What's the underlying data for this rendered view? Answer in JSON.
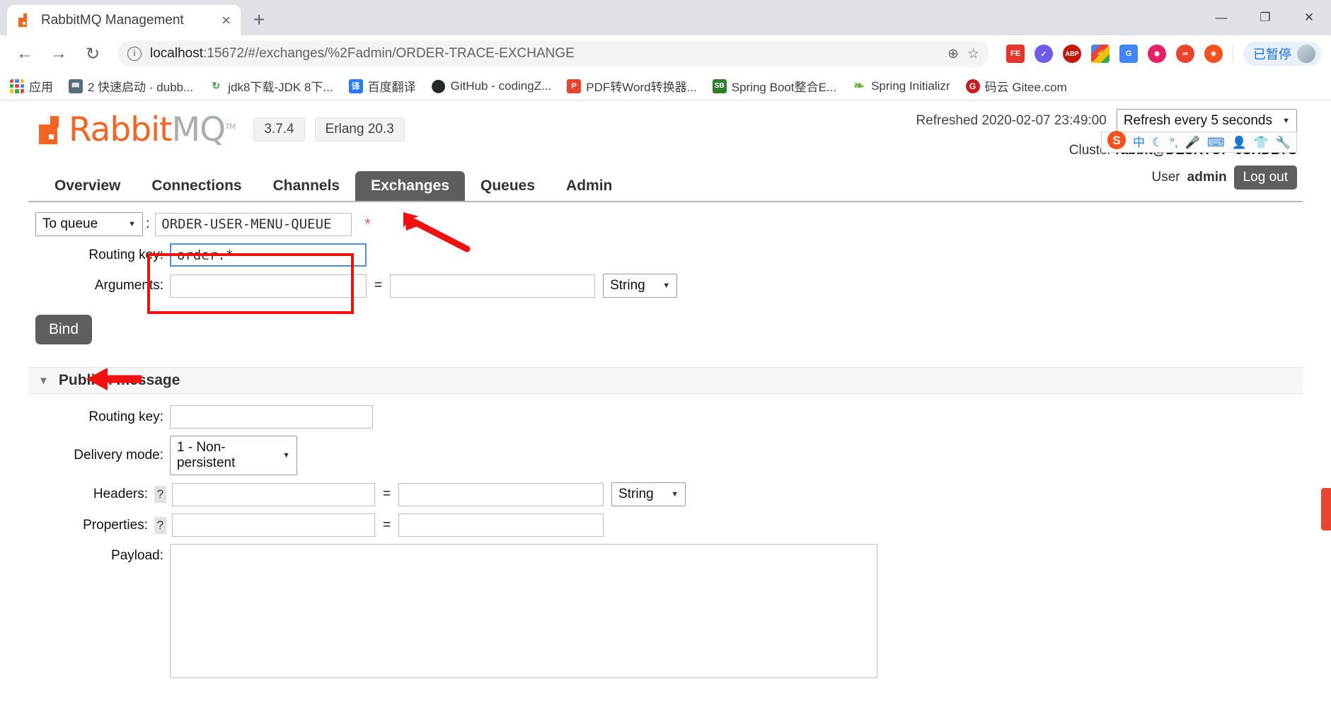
{
  "browser": {
    "tab": {
      "title": "RabbitMQ Management",
      "favicon": "rabbitmq-icon",
      "close": "×"
    },
    "newtab_label": "+",
    "window_controls": {
      "minimize": "—",
      "maximize": "❐",
      "close": "✕"
    },
    "nav": {
      "back": "←",
      "forward": "→",
      "reload": "↻"
    },
    "omnibox": {
      "info_icon": "ⓘ",
      "url_host": "localhost",
      "url_rest": ":15672/#/exchanges/%2Fadmin/ORDER-TRACE-EXCHANGE",
      "zoom_icon": "⊕",
      "bookmark_icon": "☆"
    },
    "extensions": [
      {
        "name": "fe-extension",
        "label": "FE",
        "color": "#e8342a"
      },
      {
        "name": "check-extension",
        "label": "✓",
        "color": "#6c5ce7"
      },
      {
        "name": "adblock-plus-extension",
        "label": "ABP",
        "color": "#c4170c"
      },
      {
        "name": "lightning-extension",
        "label": "⚡",
        "color": "#34a853"
      },
      {
        "name": "google-translate-extension",
        "label": "G",
        "color": "#4285f4"
      },
      {
        "name": "photos-extension",
        "label": "✿",
        "color": "#e91e63"
      },
      {
        "name": "infinity-extension",
        "label": "∞",
        "color": "#e8452c"
      },
      {
        "name": "odnoklassniki-extension",
        "label": "✶",
        "color": "#f4511e"
      }
    ],
    "paused_label": "已暂停",
    "bookmarks": [
      {
        "name": "apps",
        "label": "应用",
        "icon": "apps-grid",
        "color": ""
      },
      {
        "name": "dubbo-bookmark",
        "label": "2 快速启动 · dubb...",
        "icon": "book",
        "color": "#546e7a"
      },
      {
        "name": "jdk8-bookmark",
        "label": "jdk8下载-JDK 8下...",
        "icon": "c2",
        "color": "#ffffff"
      },
      {
        "name": "baidu-translate-bookmark",
        "label": "百度翻译",
        "icon": "yi",
        "color": "#2979ff"
      },
      {
        "name": "github-bookmark",
        "label": "GitHub - codingZ...",
        "icon": "github",
        "color": "#24292e"
      },
      {
        "name": "pdf2word-bookmark",
        "label": "PDF转Word转换器...",
        "icon": "pdf",
        "color": "#e8452c"
      },
      {
        "name": "spring-boot-bookmark",
        "label": "Spring Boot整合E...",
        "icon": "sb",
        "color": "#2e7d32"
      },
      {
        "name": "spring-initializr-bookmark",
        "label": "Spring Initializr",
        "icon": "leaf",
        "color": "#6db33f"
      },
      {
        "name": "gitee-bookmark",
        "label": "码云 Gitee.com",
        "icon": "gitee",
        "color": "#c71d23"
      }
    ]
  },
  "app": {
    "logo": {
      "rabbit": "Rabbit",
      "mq": "MQ",
      "tm": "TM"
    },
    "version_pill": "3.7.4",
    "erlang_pill": "Erlang 20.3",
    "refreshed_label": "Refreshed 2020-02-07 23:49:00",
    "refresh_select": "Refresh every 5 seconds",
    "cluster_label": "Cluster",
    "cluster_name": "rabbit@DESKTOP-0SHDB7S",
    "user_label": "User",
    "user_name": "admin",
    "logout_label": "Log out",
    "ime_icons": [
      "sogou-icon",
      "chinese-mode-icon",
      "moon-icon",
      "punctuation-icon",
      "microphone-icon",
      "keyboard-icon",
      "user-icon",
      "skin-icon",
      "toolbox-icon"
    ],
    "ime_glyphs": [
      "S",
      "中",
      "☾",
      "°,",
      "⬤",
      "⌨",
      "☺",
      "ὅ5",
      "ὒ7"
    ],
    "tabs": [
      {
        "name": "tab-overview",
        "label": "Overview",
        "active": false
      },
      {
        "name": "tab-connections",
        "label": "Connections",
        "active": false
      },
      {
        "name": "tab-channels",
        "label": "Channels",
        "active": false
      },
      {
        "name": "tab-exchanges",
        "label": "Exchanges",
        "active": true
      },
      {
        "name": "tab-queues",
        "label": "Queues",
        "active": false
      },
      {
        "name": "tab-admin",
        "label": "Admin",
        "active": false
      }
    ]
  },
  "bindings_form": {
    "target_select": "To queue",
    "colon": ":",
    "destination_value": "ORDER-USER-MENU-QUEUE",
    "required_mark": "*",
    "routing_key_label": "Routing key:",
    "routing_key_value": "order.*",
    "arguments_label": "Arguments:",
    "arguments_key": "",
    "arguments_value": "",
    "equals": "=",
    "arg_type": "String",
    "bind_button": "Bind"
  },
  "publish": {
    "section_title": "Publish message",
    "caret": "▼",
    "routing_key_label": "Routing key:",
    "routing_key_value": "",
    "delivery_mode_label": "Delivery mode:",
    "delivery_mode_value": "1 - Non-persistent",
    "headers_label": "Headers:",
    "headers_help": "?",
    "headers_key": "",
    "headers_value": "",
    "headers_type": "String",
    "properties_label": "Properties:",
    "properties_help": "?",
    "properties_key": "",
    "properties_value": "",
    "payload_label": "Payload:",
    "payload_value": "",
    "equals": "="
  },
  "annotations": {
    "arrow_to_exchanges": "red-arrow-pointing-to-exchanges-tab",
    "arrow_to_bind": "red-arrow-pointing-to-bind-button",
    "highlight_binding_inputs": "red-rectangle-around-destination-and-routing-key"
  },
  "colors": {
    "accent_orange": "#f26522",
    "annotation_red": "#f01010",
    "tab_active_bg": "#5e5e5e",
    "link_blue": "#1a73e8"
  }
}
